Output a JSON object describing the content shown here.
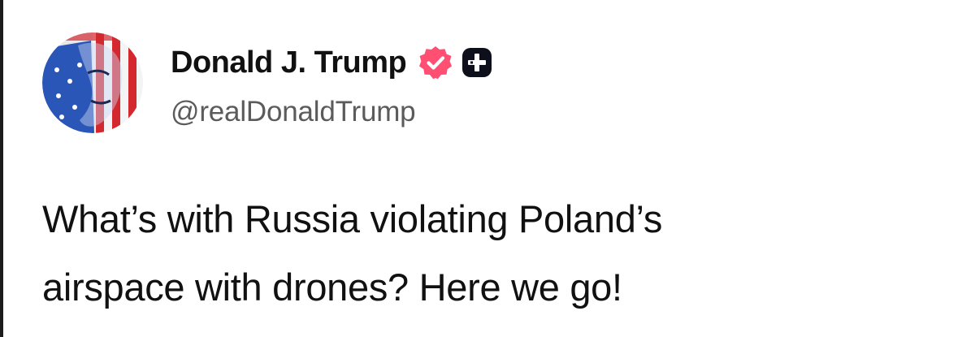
{
  "author": {
    "display_name": "Donald J. Trump",
    "handle": "@realDonaldTrump",
    "avatar_icon": "american-flag-portrait-avatar",
    "badges": [
      {
        "icon": "verified-badge-icon",
        "color": "#ff4f73"
      },
      {
        "icon": "plus-badge-icon",
        "color": "#0d0f1a"
      }
    ]
  },
  "post": {
    "lines": [
      "What’s with Russia violating Poland’s",
      "airspace with drones? Here we go!"
    ]
  },
  "colors": {
    "background": "#ffffff",
    "text": "#111111",
    "handle": "#5b5b5b",
    "verified_accent": "#ff4f73"
  }
}
